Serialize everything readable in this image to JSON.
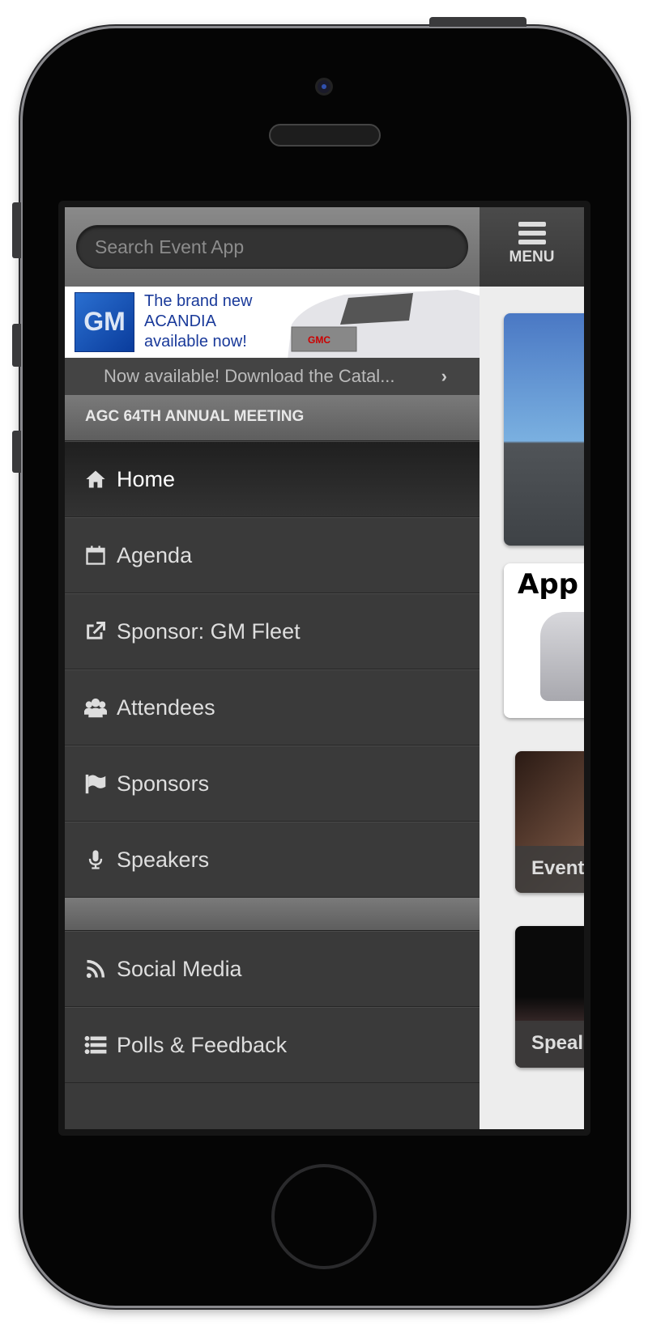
{
  "search": {
    "placeholder": "Search Event App"
  },
  "menu": {
    "label": "MENU"
  },
  "ad": {
    "logo": "GM",
    "line1": "The brand new",
    "line2": "ACANDIA",
    "line3": "available now!"
  },
  "notice": {
    "text": "Now available! Download the Catal..."
  },
  "section_title": "AGC 64TH ANNUAL MEETING",
  "nav": [
    {
      "label": "Home",
      "icon": "home-icon"
    },
    {
      "label": "Agenda",
      "icon": "calendar-icon"
    },
    {
      "label": "Sponsor: GM Fleet",
      "icon": "external-link-icon"
    },
    {
      "label": "Attendees",
      "icon": "users-icon"
    },
    {
      "label": "Sponsors",
      "icon": "flag-icon"
    },
    {
      "label": "Speakers",
      "icon": "microphone-icon"
    }
  ],
  "nav2": [
    {
      "label": "Social Media",
      "icon": "rss-icon"
    },
    {
      "label": "Polls & Feedback",
      "icon": "list-icon"
    }
  ],
  "cards": {
    "app_text": "App",
    "events_label": "Event",
    "speakers_label": "Speal"
  }
}
